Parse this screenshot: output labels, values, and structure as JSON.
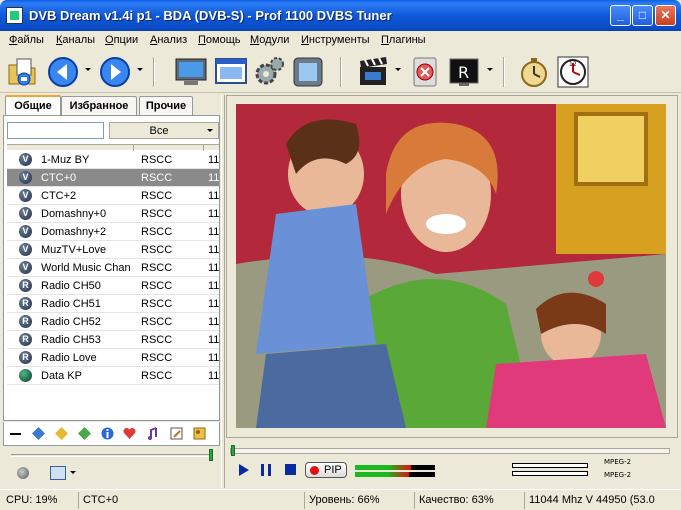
{
  "window": {
    "title": "DVB Dream v1.4i p1 - BDA (DVB-S)  -  Prof 1100 DVBS Tuner",
    "minimize": "_",
    "maximize": "□",
    "close": "✕"
  },
  "menu": [
    {
      "accel": "Ф",
      "rest": "айлы"
    },
    {
      "accel": "К",
      "rest": "аналы"
    },
    {
      "accel": "О",
      "rest": "пции"
    },
    {
      "accel": "А",
      "rest": "нализ"
    },
    {
      "accel": "П",
      "rest": "омощь"
    },
    {
      "accel": "М",
      "rest": "одули"
    },
    {
      "accel": "И",
      "rest": "нструменты"
    },
    {
      "accel": "П",
      "rest": "лагины"
    }
  ],
  "toolbar": {
    "icons": [
      "open-folder-icon",
      "back-arrow-icon",
      "forward-arrow-icon",
      "monitor-icon",
      "window-icon",
      "gears-icon",
      "fullscreen-icon",
      "clapper-icon",
      "record-icon",
      "radio-r-icon",
      "timer-icon",
      "clock-icon"
    ]
  },
  "left_panel": {
    "tabs": [
      "Общие",
      "Избранное",
      "Прочие"
    ],
    "search_value": "",
    "filter_value": "Все",
    "channels": [
      {
        "name": "1-Muz BY",
        "provider": "RSCC",
        "num": "11",
        "type": "V",
        "selected": false
      },
      {
        "name": "CTC+0",
        "provider": "RSCC",
        "num": "11",
        "type": "V",
        "selected": true
      },
      {
        "name": "CTC+2",
        "provider": "RSCC",
        "num": "11",
        "type": "V",
        "selected": false
      },
      {
        "name": "Domashny+0",
        "provider": "RSCC",
        "num": "11",
        "type": "V",
        "selected": false
      },
      {
        "name": "Domashny+2",
        "provider": "RSCC",
        "num": "11",
        "type": "V",
        "selected": false
      },
      {
        "name": "MuzTV+Love",
        "provider": "RSCC",
        "num": "11",
        "type": "V",
        "selected": false
      },
      {
        "name": "World Music Chan...",
        "provider": "RSCC",
        "num": "11",
        "type": "V",
        "selected": false
      },
      {
        "name": "Radio CH50",
        "provider": "RSCC",
        "num": "11",
        "type": "R",
        "selected": false
      },
      {
        "name": "Radio CH51",
        "provider": "RSCC",
        "num": "11",
        "type": "R",
        "selected": false
      },
      {
        "name": "Radio CH52",
        "provider": "RSCC",
        "num": "11",
        "type": "R",
        "selected": false
      },
      {
        "name": "Radio CH53",
        "provider": "RSCC",
        "num": "11",
        "type": "R",
        "selected": false
      },
      {
        "name": "Radio Love",
        "provider": "RSCC",
        "num": "11",
        "type": "R",
        "selected": false
      },
      {
        "name": "Data KP",
        "provider": "RSCC",
        "num": "11",
        "type": "D",
        "selected": false
      }
    ]
  },
  "player": {
    "pip_label": "PIP",
    "audio_format_1": "MPEG-2",
    "audio_format_2": "MPEG-2",
    "seek_progress": 0.0,
    "level_top": 0.7,
    "level_bottom": 0.68
  },
  "status": {
    "cpu": "CPU: 19%",
    "channel": "CTC+0",
    "level": "Уровень: 66%",
    "quality": "Качество: 63%",
    "freq": "11044 Mhz  V  44950  (53.0"
  },
  "colors": {
    "selected_row": "#8a8a8a",
    "title_bar": "#0a5fe8",
    "level_green": "#1db81d",
    "level_red": "#e01010"
  }
}
